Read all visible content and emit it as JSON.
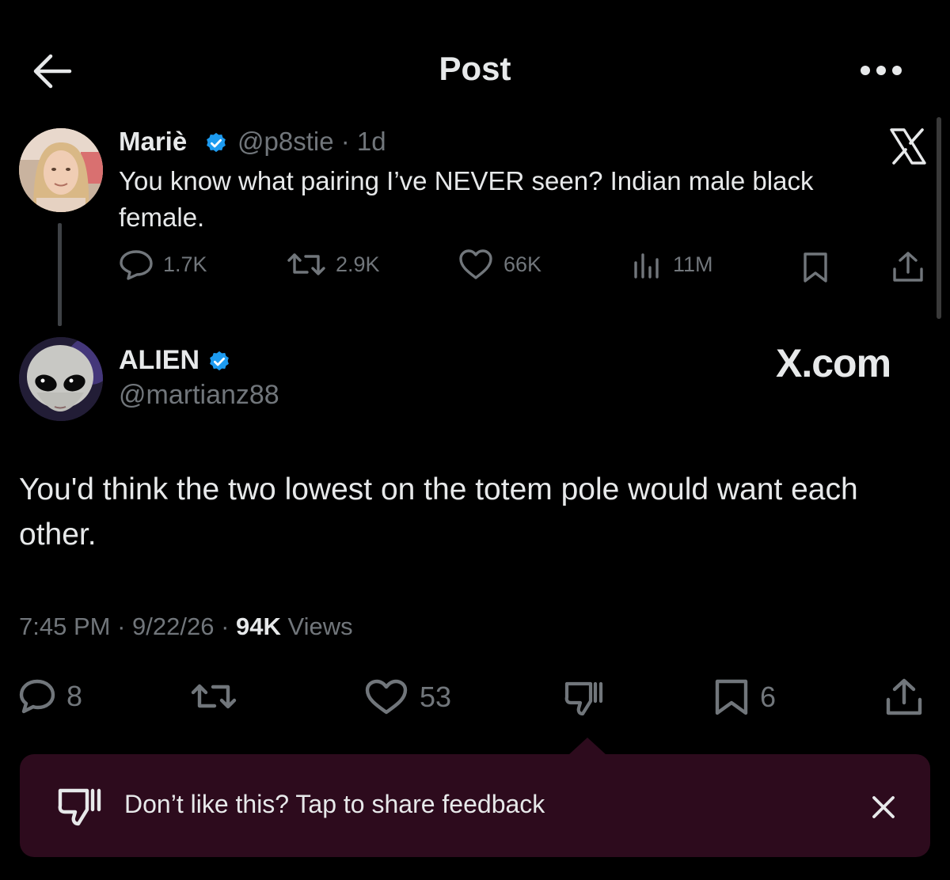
{
  "header": {
    "title": "Post",
    "back_icon": "arrow-left-icon",
    "more_icon": "more-horizontal-icon"
  },
  "quoted_tweet": {
    "author_name": "Mariè",
    "handle_time": "@p8stie · 1d",
    "text": "You know what pairing I’ve NEVER seen? Indian male black female.",
    "stats": {
      "replies": "1.7K",
      "reposts": "2.9K",
      "likes": "66K",
      "views": "11M"
    }
  },
  "main_tweet": {
    "author_name": "ALIEN",
    "handle": "@martianz88",
    "watermark": "X.com",
    "text": "You'd think the two lowest on the totem pole would want each other.",
    "meta": {
      "time": "7:45 PM",
      "date": "9/22/26",
      "views_count": "94K",
      "views_label": "Views"
    },
    "actions": {
      "replies": "8",
      "likes": "53",
      "bookmarks": "6"
    }
  },
  "feedback_toast": {
    "text": "Don’t like this? Tap to share feedback"
  },
  "colors": {
    "background": "#000000",
    "text_primary": "#e7e9ea",
    "text_secondary": "#71767b",
    "verified_blue": "#1d9bf0",
    "toast_bg": "#2d0b1d"
  }
}
